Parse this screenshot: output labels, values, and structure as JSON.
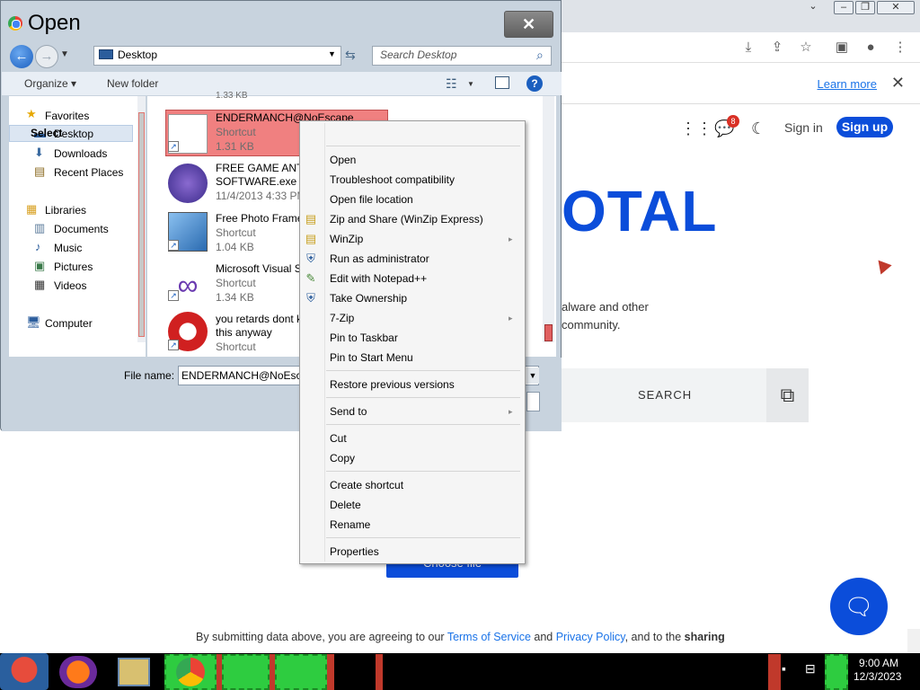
{
  "browser": {
    "learn_more": "Learn more",
    "close_glyph": "✕",
    "header": {
      "badge_count": "8",
      "sign_in": "Sign in",
      "sign_up": "Sign up"
    },
    "logo_partial": "OTAL",
    "desc_line1": "alware and other",
    "desc_line2": "community.",
    "search_label": "SEARCH",
    "choose_file": "Choose file",
    "terms": {
      "prefix": "By submitting data above, you are agreeing to our ",
      "tos": "Terms of Service",
      "and": " and ",
      "privacy": "Privacy Policy",
      "suffix": ", and to the ",
      "sharing": "sharing"
    }
  },
  "dialog": {
    "title": "Open",
    "close_glyph": "✕",
    "address": "Desktop",
    "search_placeholder": "Search Desktop",
    "toolbar": {
      "organize": "Organize",
      "new_folder": "New folder"
    },
    "nav": {
      "favorites": "Favorites",
      "desktop": "Desktop",
      "downloads": "Downloads",
      "recent_places": "Recent Places",
      "libraries": "Libraries",
      "documents": "Documents",
      "music": "Music",
      "pictures": "Pictures",
      "videos": "Videos",
      "computer": "Computer"
    },
    "files": [
      {
        "name": "ENDERMANCH@NoEscape",
        "line2": "Shortcut",
        "line3": "1.31 KB"
      },
      {
        "name": "FREE GAME ANTI",
        "line2": "SOFTWARE.exe",
        "line3": "11/4/2013 4:33 PM"
      },
      {
        "name": "Free Photo Frame",
        "line2": "Shortcut",
        "line3": "1.04 KB"
      },
      {
        "name": "Microsoft Visual S",
        "line2": "Shortcut",
        "line3": "1.34 KB"
      },
      {
        "name": "you retards dont k",
        "line2": "this anyway",
        "line3": "Shortcut"
      }
    ],
    "top_partial": "1.33 KB",
    "file_name_label": "File name:",
    "file_name_value": "ENDERMANCH@NoEscape"
  },
  "context_menu": {
    "select": "Select",
    "open": "Open",
    "troubleshoot": "Troubleshoot compatibility",
    "open_location": "Open file location",
    "zip_share": "Zip and Share (WinZip Express)",
    "winzip": "WinZip",
    "run_admin": "Run as administrator",
    "edit_notepad": "Edit with Notepad++",
    "take_ownership": "Take Ownership",
    "seven_zip": "7-Zip",
    "pin_taskbar": "Pin to Taskbar",
    "pin_start": "Pin to Start Menu",
    "restore_prev": "Restore previous versions",
    "send_to": "Send to",
    "cut": "Cut",
    "copy": "Copy",
    "create_shortcut": "Create shortcut",
    "delete": "Delete",
    "rename": "Rename",
    "properties": "Properties"
  },
  "taskbar": {
    "time": "9:00 AM",
    "date": "12/3/2023"
  },
  "colors": {
    "accent": "#0b4dda",
    "selection": "#f08080",
    "taskbar": "#000000"
  }
}
